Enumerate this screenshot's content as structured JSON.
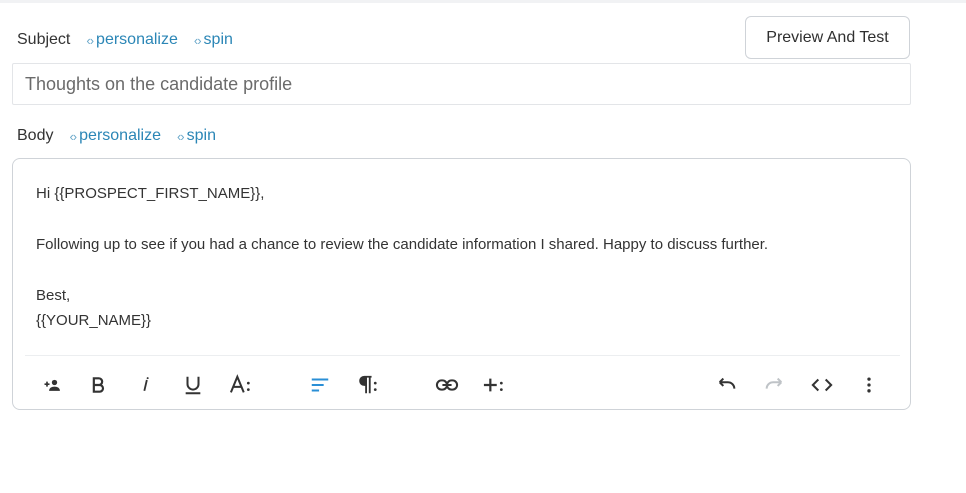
{
  "subject": {
    "label": "Subject",
    "personalize": "personalize",
    "spin": "spin",
    "value": "Thoughts on the candidate profile"
  },
  "preview_button": "Preview And Test",
  "body": {
    "label": "Body",
    "personalize": "personalize",
    "spin": "spin",
    "lines": {
      "greeting": "Hi {{PROSPECT_FIRST_NAME}},",
      "message": "Following up to see if you had a chance to review the candidate information I shared. Happy to discuss further.",
      "signoff": "Best,",
      "signature": "{{YOUR_NAME}}"
    }
  },
  "toolbar": {
    "icons": [
      "add-person-icon",
      "bold-icon",
      "italic-icon",
      "underline-icon",
      "font-size-icon",
      "align-left-icon",
      "paragraph-icon",
      "link-icon",
      "insert-more-icon",
      "undo-icon",
      "redo-icon",
      "code-view-icon",
      "more-vert-icon"
    ],
    "code_glyph": "‹›"
  },
  "colors": {
    "accent": "#2b86b6",
    "active_tool": "#2a8fd6",
    "disabled_tool": "#bfc3c7",
    "border": "#cfd3d8"
  }
}
